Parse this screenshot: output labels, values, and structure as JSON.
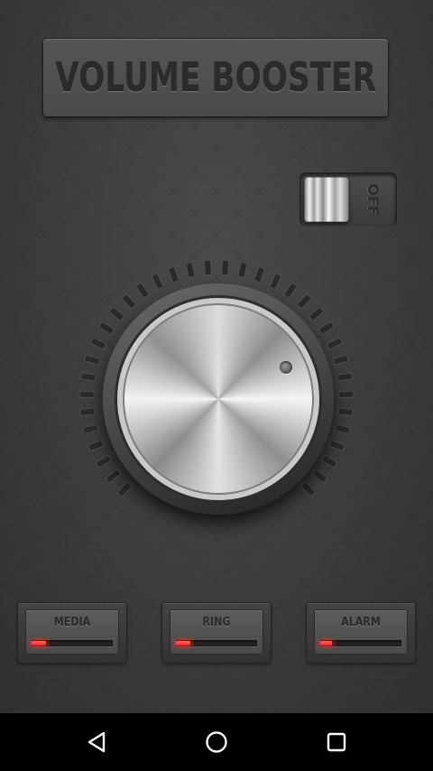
{
  "app": {
    "title": "VOLUME BOOSTER",
    "toggle": {
      "label": "OFF",
      "state": "off"
    },
    "dial": {
      "tick_count": 36,
      "accent_color": "#c8c8c8"
    },
    "sliders": [
      {
        "label": "MEDIA",
        "level": 0.18
      },
      {
        "label": "RING",
        "level": 0.18
      },
      {
        "label": "ALARM",
        "level": 0.14
      }
    ],
    "slider_fill_color": "#e8281c"
  },
  "navbar": {
    "buttons": [
      {
        "icon": "back-triangle-icon"
      },
      {
        "icon": "home-circle-icon"
      },
      {
        "icon": "recents-square-icon"
      }
    ]
  }
}
